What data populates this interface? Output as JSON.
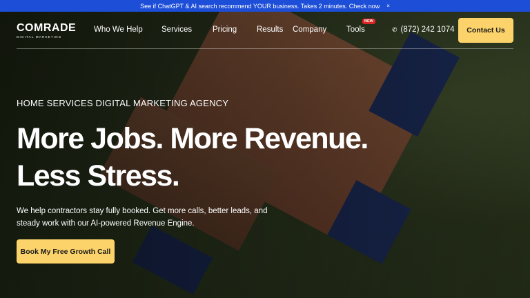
{
  "announcement": {
    "text": "See if ChatGPT & AI search recommend YOUR business. Takes 2 minutes. Check now",
    "close_glyph": "×"
  },
  "brand": {
    "name": "COMRADE",
    "tagline": "DIGITAL MARKETING"
  },
  "nav": {
    "items": [
      {
        "label": "Who We Help"
      },
      {
        "label": "Services"
      },
      {
        "label": "Pricing"
      },
      {
        "label": "Results"
      },
      {
        "label": "Company"
      },
      {
        "label": "Tools",
        "badge": "NEW"
      }
    ],
    "phone": "(872) 242 1074",
    "phone_icon": "phone-icon",
    "contact_label": "Contact Us"
  },
  "hero": {
    "eyebrow": "HOME SERVICES DIGITAL MARKETING AGENCY",
    "headline_line1": "More Jobs. More Revenue.",
    "headline_line2": "Less Stress.",
    "description": "We help contractors stay fully booked. Get more calls, better leads, and steady work with our AI-powered Revenue Engine.",
    "cta_label": "Book My Free Growth Call"
  },
  "colors": {
    "announcement_bg": "#1d4ed8",
    "accent": "#fcd36a",
    "badge": "#dc2626"
  }
}
